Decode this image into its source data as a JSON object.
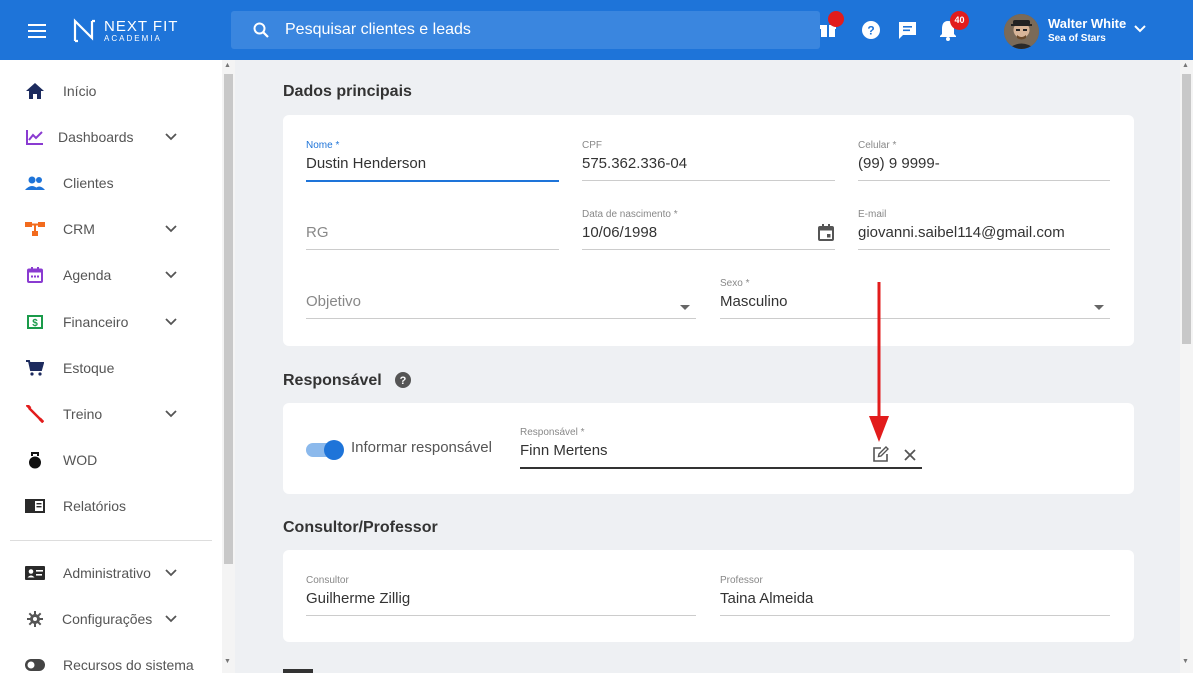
{
  "topbar": {
    "logo_line1": "NEXT FIT",
    "logo_line2": "ACADEMIA",
    "search_placeholder": "Pesquisar clientes e leads",
    "notifications_count": "40",
    "user_name": "Walter White",
    "user_org": "Sea of Stars"
  },
  "sidebar": {
    "items": [
      {
        "label": "Início",
        "icon": "home-icon"
      },
      {
        "label": "Dashboards",
        "icon": "chart-icon"
      },
      {
        "label": "Clientes",
        "icon": "people-icon"
      },
      {
        "label": "CRM",
        "icon": "crm-icon"
      },
      {
        "label": "Agenda",
        "icon": "calendar-icon"
      },
      {
        "label": "Financeiro",
        "icon": "money-icon"
      },
      {
        "label": "Estoque",
        "icon": "cart-icon"
      },
      {
        "label": "Treino",
        "icon": "dumbbell-icon"
      },
      {
        "label": "WOD",
        "icon": "kettlebell-icon"
      },
      {
        "label": "Relatórios",
        "icon": "report-icon"
      },
      {
        "label": "Administrativo",
        "icon": "id-card-icon"
      },
      {
        "label": "Configurações",
        "icon": "gear-icon"
      },
      {
        "label": "Recursos do sistema",
        "icon": "toggle-icon"
      }
    ]
  },
  "dados_principais": {
    "title": "Dados principais",
    "nome_label": "Nome *",
    "nome_value": "Dustin Henderson",
    "cpf_label": "CPF",
    "cpf_value": "575.362.336-04",
    "celular_label": "Celular *",
    "celular_value": "(99) 9 9999-",
    "rg_placeholder": "RG",
    "nascimento_label": "Data de nascimento *",
    "nascimento_value": "10/06/1998",
    "email_label": "E-mail",
    "email_value": "giovanni.saibel114@gmail.com",
    "objetivo_placeholder": "Objetivo",
    "sexo_label": "Sexo *",
    "sexo_value": "Masculino"
  },
  "responsavel": {
    "title": "Responsável",
    "toggle_label": "Informar responsável",
    "toggle_on": true,
    "field_label": "Responsável *",
    "field_value": "Finn Mertens"
  },
  "consultor": {
    "title": "Consultor/Professor",
    "consultor_label": "Consultor",
    "consultor_value": "Guilherme Zillig",
    "professor_label": "Professor",
    "professor_value": "Taina Almeida"
  },
  "colors": {
    "primary": "#1e74d9",
    "annotation_arrow": "#e21c1c"
  }
}
